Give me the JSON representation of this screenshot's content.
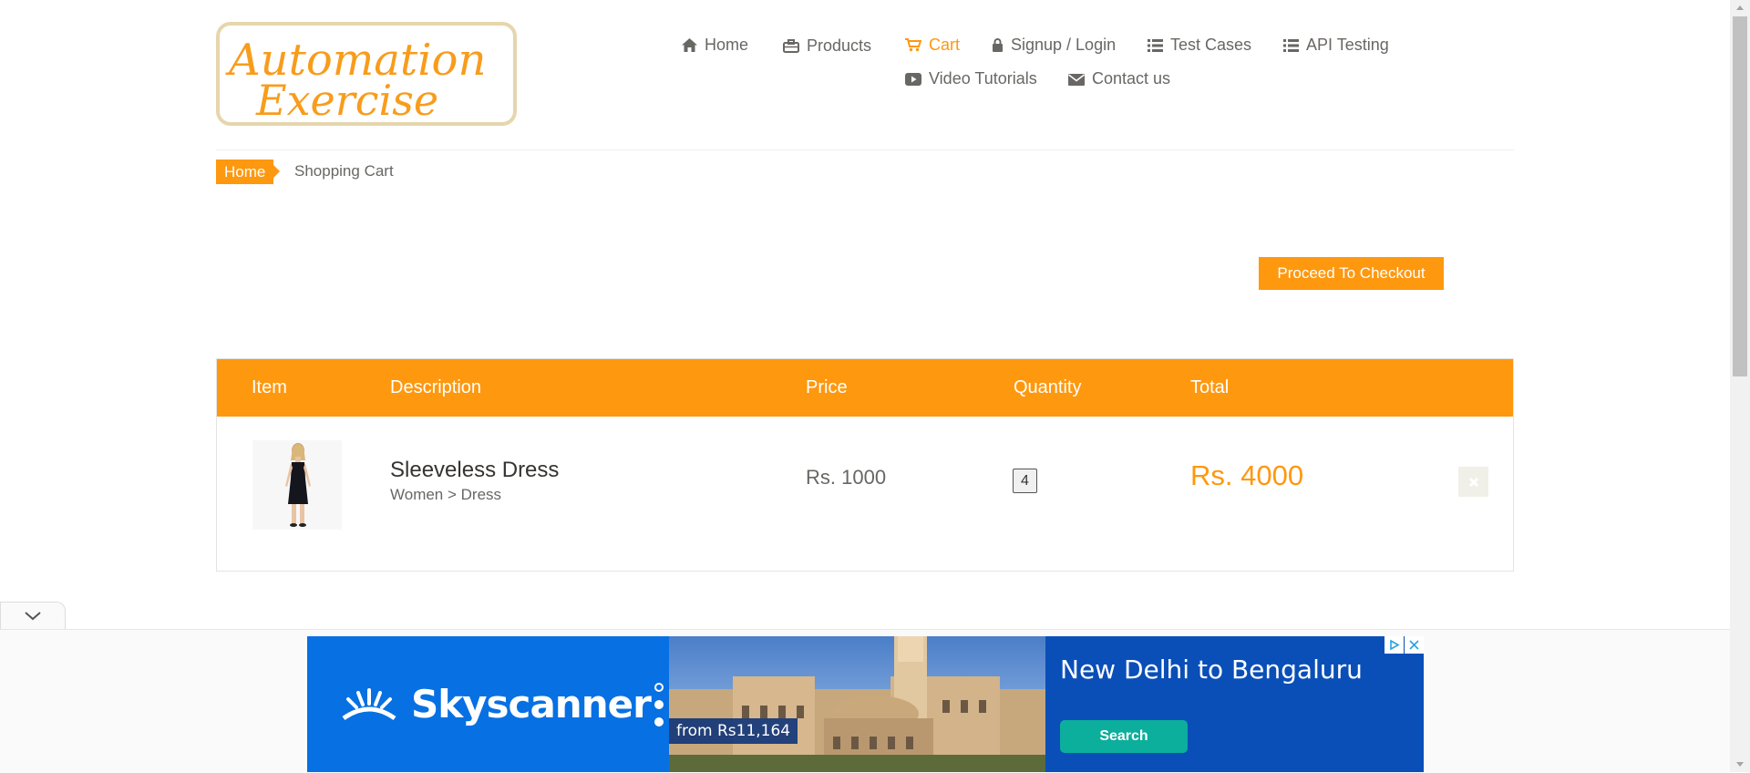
{
  "logo": {
    "line1": "Automation",
    "line2": "Exercise"
  },
  "nav": {
    "home": "Home",
    "products": "Products",
    "cart": "Cart",
    "signup_login": "Signup / Login",
    "test_cases": "Test Cases",
    "api_testing": "API Testing",
    "video_tutorials": "Video Tutorials",
    "contact_us": "Contact us"
  },
  "breadcrumb": {
    "home": "Home",
    "current": "Shopping Cart"
  },
  "checkout_button": "Proceed To Checkout",
  "table": {
    "headers": {
      "item": "Item",
      "description": "Description",
      "price": "Price",
      "quantity": "Quantity",
      "total": "Total"
    },
    "rows": [
      {
        "name": "Sleeveless Dress",
        "category": "Women > Dress",
        "price": "Rs. 1000",
        "quantity": "4",
        "total": "Rs. 4000"
      }
    ]
  },
  "ad": {
    "brand": "Skyscanner",
    "price_tag": "from Rs11,164",
    "headline": "New Delhi to Bengaluru",
    "search_button": "Search"
  },
  "colors": {
    "accent": "#fe980f",
    "text": "#696763",
    "ad_blue": "#0770e3",
    "ad_teal": "#0cae9c"
  }
}
